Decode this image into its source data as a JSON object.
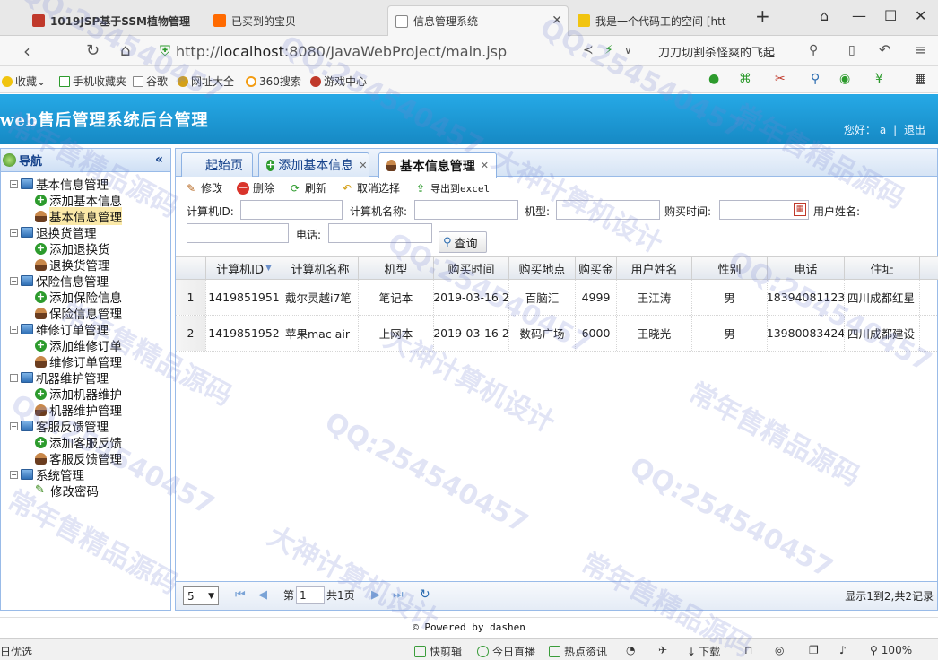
{
  "browser": {
    "tabs": [
      {
        "title": "1019JSP基于SSM植物管理",
        "icon_color": "#c0392b"
      },
      {
        "title": "已买到的宝贝",
        "icon_color": "#ff6a00"
      },
      {
        "title": "信息管理系统",
        "icon_color": "#888888"
      },
      {
        "title": "我是一个代码工的空间 [htt",
        "icon_color": "#f1c40f"
      }
    ],
    "new_tab": "+",
    "url_prefix": "http://",
    "url_host": "localhost",
    "url_rest": ":8080/JavaWebProject/main.jsp",
    "search_text": "刀刀切割杀怪爽的飞起",
    "bookmarks": [
      "收藏",
      "手机收藏夹",
      "谷歌",
      "网址大全",
      "360搜索",
      "游戏中心"
    ]
  },
  "app": {
    "title": "web售后管理系统后台管理",
    "greeting": "您好：",
    "username": "a",
    "separator": "|",
    "logout": "退出"
  },
  "nav": {
    "title": "导航",
    "collapse": "«",
    "groups": [
      {
        "label": "基本信息管理",
        "children": [
          {
            "label": "添加基本信息",
            "icon": "add-icon"
          },
          {
            "label": "基本信息管理",
            "icon": "user-icon",
            "selected": true
          }
        ]
      },
      {
        "label": "退换货管理",
        "children": [
          {
            "label": "添加退换货",
            "icon": "add-icon"
          },
          {
            "label": "退换货管理",
            "icon": "user-icon"
          }
        ]
      },
      {
        "label": "保险信息管理",
        "children": [
          {
            "label": "添加保险信息",
            "icon": "add-icon"
          },
          {
            "label": "保险信息管理",
            "icon": "user-icon"
          }
        ]
      },
      {
        "label": "维修订单管理",
        "children": [
          {
            "label": "添加维修订单",
            "icon": "add-icon"
          },
          {
            "label": "维修订单管理",
            "icon": "user-icon"
          }
        ]
      },
      {
        "label": "机器维护管理",
        "children": [
          {
            "label": "添加机器维护",
            "icon": "add-icon"
          },
          {
            "label": "机器维护管理",
            "icon": "user-icon"
          }
        ]
      },
      {
        "label": "客服反馈管理",
        "children": [
          {
            "label": "添加客服反馈",
            "icon": "add-icon"
          },
          {
            "label": "客服反馈管理",
            "icon": "user-icon"
          }
        ]
      },
      {
        "label": "系统管理",
        "children": [
          {
            "label": "修改密码",
            "icon": "pencil-icon"
          }
        ]
      }
    ]
  },
  "tabs": [
    {
      "label": "起始页",
      "closable": false
    },
    {
      "label": "添加基本信息",
      "closable": true
    },
    {
      "label": "基本信息管理",
      "closable": true,
      "active": true
    }
  ],
  "toolbar": {
    "edit": "修改",
    "delete": "删除",
    "refresh": "刷新",
    "deselect": "取消选择",
    "export": "导出到excel"
  },
  "filter": {
    "computer_id": "计算机ID:",
    "computer_name": "计算机名称:",
    "model": "机型:",
    "purchase_time": "购买时间:",
    "user_name": "用户姓名:",
    "phone": "电话:",
    "query": "查询"
  },
  "grid": {
    "columns": [
      "计算机ID",
      "计算机名称",
      "机型",
      "购买时间",
      "购买地点",
      "购买金",
      "用户姓名",
      "性别",
      "电话",
      "住址"
    ],
    "rows": [
      {
        "n": "1",
        "id": "1419851951",
        "name": "戴尔灵越i7笔",
        "model": "笔记本",
        "time": "2019-03-16 2",
        "place": "百脑汇",
        "price": "4999",
        "user": "王江涛",
        "gender": "男",
        "phone": "18394081123",
        "addr": "四川成都红星"
      },
      {
        "n": "2",
        "id": "1419851952",
        "name": "苹果mac air",
        "model": "上网本",
        "time": "2019-03-16 2",
        "place": "数码广场",
        "price": "6000",
        "user": "王晓光",
        "gender": "男",
        "phone": "13980083424",
        "addr": "四川成都建设"
      }
    ]
  },
  "pager": {
    "page_size": "5",
    "page_prefix": "第",
    "page_value": "1",
    "page_suffix": "共1页",
    "summary": "显示1到2,共2记录"
  },
  "footer": {
    "text": "© Powered by dashen"
  },
  "statusbar": {
    "left": "日优选",
    "items": [
      "快剪辑",
      "今日直播",
      "热点资讯",
      "下载"
    ],
    "zoom": "100%"
  },
  "watermark": {
    "qq": "QQ:254540457",
    "a": "大神计算机设计",
    "b": "常年售精品源码"
  }
}
